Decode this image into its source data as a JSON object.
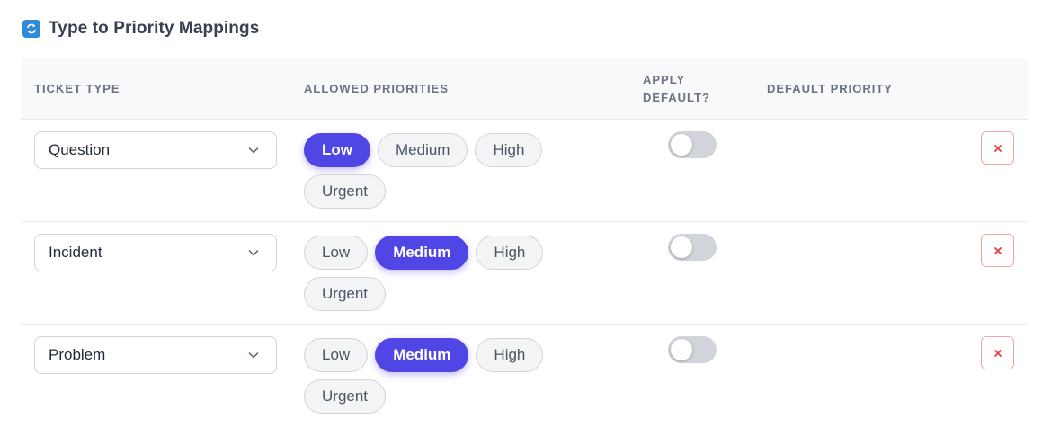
{
  "section": {
    "title": "Type to Priority Mappings",
    "icon": "refresh-icon"
  },
  "columns": {
    "ticket_type": "TICKET TYPE",
    "allowed_priorities": "ALLOWED PRIORITIES",
    "apply_default": "APPLY DEFAULT?",
    "default_priority": "DEFAULT PRIORITY"
  },
  "rows": [
    {
      "type": "Question",
      "priorities": [
        "Low",
        "Medium",
        "High",
        "Urgent"
      ],
      "selected": [
        "Low"
      ],
      "apply_default": false,
      "default_priority": ""
    },
    {
      "type": "Incident",
      "priorities": [
        "Low",
        "Medium",
        "High",
        "Urgent"
      ],
      "selected": [
        "Medium"
      ],
      "apply_default": false,
      "default_priority": ""
    },
    {
      "type": "Problem",
      "priorities": [
        "Low",
        "Medium",
        "High",
        "Urgent"
      ],
      "selected": [
        "Medium"
      ],
      "apply_default": false,
      "default_priority": ""
    }
  ],
  "colors": {
    "accent": "#4f46e5",
    "danger": "#e53e3e",
    "icon_bg": "#2f8bd8"
  }
}
